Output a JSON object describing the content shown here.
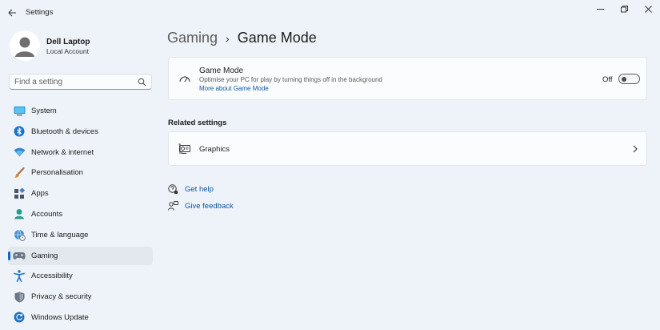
{
  "window": {
    "title": "Settings",
    "controls": [
      "minimize-icon",
      "restore-icon",
      "close-icon"
    ]
  },
  "profile": {
    "name": "Dell Laptop",
    "account": "Local Account"
  },
  "search": {
    "placeholder": "Find a setting",
    "value": ""
  },
  "sidebar": {
    "items": [
      {
        "label": "System",
        "icon": "system-icon"
      },
      {
        "label": "Bluetooth & devices",
        "icon": "bluetooth-icon"
      },
      {
        "label": "Network & internet",
        "icon": "wifi-icon"
      },
      {
        "label": "Personalisation",
        "icon": "brush-icon"
      },
      {
        "label": "Apps",
        "icon": "apps-icon"
      },
      {
        "label": "Accounts",
        "icon": "accounts-icon"
      },
      {
        "label": "Time & language",
        "icon": "globe-clock-icon"
      },
      {
        "label": "Gaming",
        "icon": "gamepad-icon",
        "active": true
      },
      {
        "label": "Accessibility",
        "icon": "accessibility-icon"
      },
      {
        "label": "Privacy & security",
        "icon": "shield-icon"
      },
      {
        "label": "Windows Update",
        "icon": "update-icon"
      }
    ]
  },
  "breadcrumb": {
    "parent": "Gaming",
    "separator": "›",
    "current": "Game Mode"
  },
  "game_mode": {
    "title": "Game Mode",
    "description": "Optimise your PC for play by turning things off in the background",
    "link": "More about Game Mode",
    "toggle_state": "Off"
  },
  "related": {
    "heading": "Related settings",
    "items": [
      {
        "label": "Graphics",
        "icon": "graphics-card-icon"
      }
    ]
  },
  "help": {
    "get_help": "Get help",
    "give_feedback": "Give feedback"
  },
  "colors": {
    "accent": "#1366c1",
    "link": "#0a58a8",
    "background": "#eef3f9",
    "card": "#fbfcfd"
  }
}
